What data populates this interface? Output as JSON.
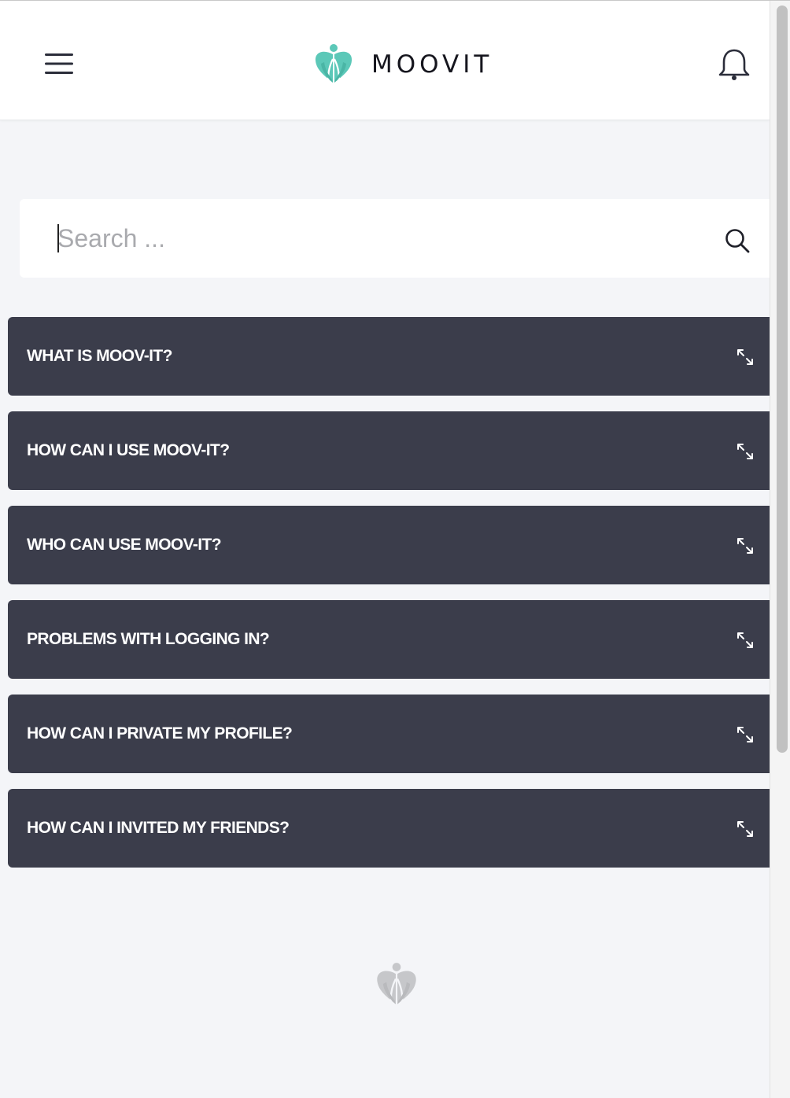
{
  "header": {
    "brand_name": "MOOVIT",
    "brand_color": "#5cc8b8",
    "menu_icon": "hamburger-menu-icon",
    "notification_icon": "bell-icon"
  },
  "search": {
    "placeholder": "Search ...",
    "value": "",
    "icon": "search-icon"
  },
  "faq": {
    "items": [
      {
        "title": "WHAT IS MOOV-IT?"
      },
      {
        "title": "HOW CAN I USE MOOV-IT?"
      },
      {
        "title": "WHO CAN USE MOOV-IT?"
      },
      {
        "title": "PROBLEMS WITH LOGGING IN?"
      },
      {
        "title": "HOW CAN I PRIVATE MY PROFILE?"
      },
      {
        "title": "HOW CAN I INVITED MY FRIENDS?"
      }
    ],
    "item_icon": "expand-arrows-icon",
    "item_color": "#3b3d4b"
  },
  "footer": {
    "logo_icon": "moovit-logo-icon",
    "logo_color": "#c6c7ca"
  }
}
